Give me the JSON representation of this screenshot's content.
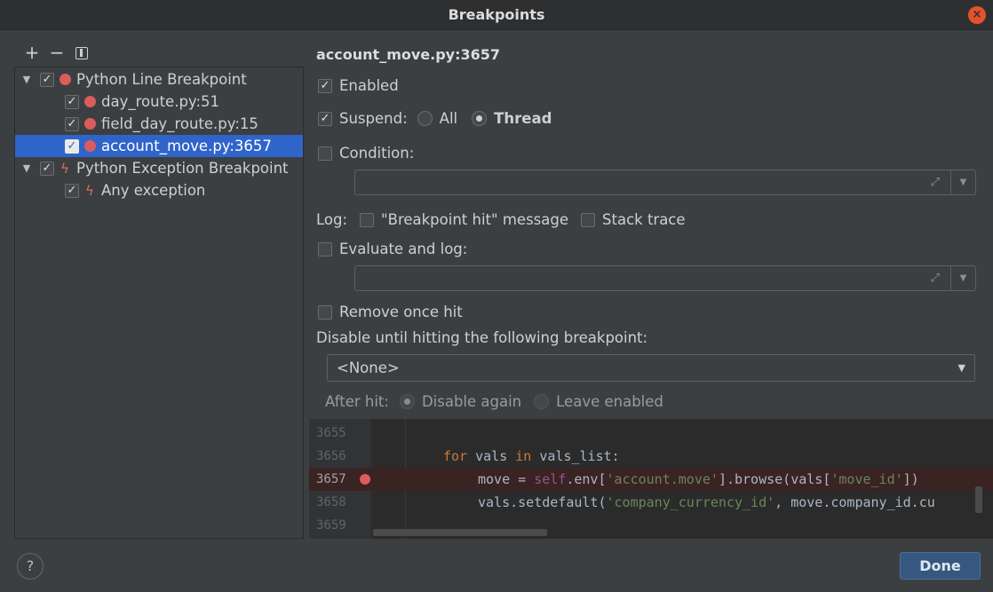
{
  "window": {
    "title": "Breakpoints",
    "close": "×"
  },
  "toolbar": {
    "add": "+",
    "remove": "−"
  },
  "tree": {
    "line_group": "Python Line Breakpoint",
    "line_items": [
      "day_route.py:51",
      "field_day_route.py:15",
      "account_move.py:3657"
    ],
    "exception_group": "Python Exception Breakpoint",
    "exception_items": [
      "Any exception"
    ]
  },
  "detail": {
    "title": "account_move.py:3657",
    "enabled": "Enabled",
    "suspend": "Suspend:",
    "suspend_all": "All",
    "suspend_thread": "Thread",
    "condition": "Condition:",
    "log": "Log:",
    "log_message": "\"Breakpoint hit\" message",
    "log_stack": "Stack trace",
    "evaluate": "Evaluate and log:",
    "remove_once": "Remove once hit",
    "disable_until": "Disable until hitting the following breakpoint:",
    "disable_until_value": "<None>",
    "after_hit": "After hit:",
    "disable_again": "Disable again",
    "leave_enabled": "Leave enabled"
  },
  "code": {
    "lines": [
      {
        "num": "3655"
      },
      {
        "num": "3656",
        "kw1": "for",
        "v1": " vals ",
        "kw2": "in",
        "v2": " vals_list:"
      },
      {
        "num": "3657",
        "a": "move = ",
        "slf": "self",
        "b": ".env[",
        "s1": "'account.move'",
        "c": "].browse(vals[",
        "s2": "'move_id'",
        "d": "])"
      },
      {
        "num": "3658",
        "a": "vals.setdefault(",
        "s1": "'company_currency_id'",
        "b": ", move.company_id.cu"
      },
      {
        "num": "3659"
      }
    ]
  },
  "footer": {
    "help": "?",
    "done": "Done"
  }
}
